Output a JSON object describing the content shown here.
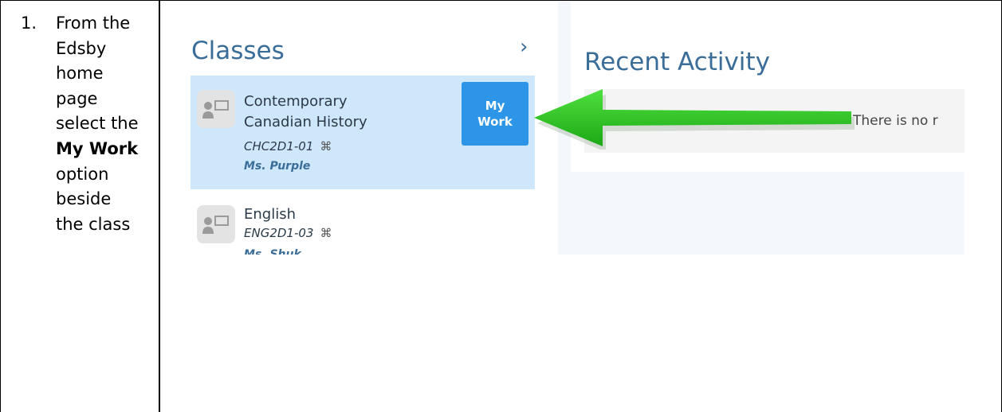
{
  "step": {
    "number": "1.",
    "text_before": "From the Edsby home page select the ",
    "text_bold": "My Work",
    "text_after": " option beside the class"
  },
  "screenshot": {
    "classes": {
      "title": "Classes",
      "chevron": "›",
      "items": [
        {
          "name": "Contemporary Canadian History",
          "code": "CHC2D1-01",
          "teacher": "Ms. Purple",
          "selected": true,
          "action_label_line1": "My",
          "action_label_line2": "Work"
        },
        {
          "name": "English",
          "code": "ENG2D1-03",
          "teacher": "Ms. Shuk"
        }
      ]
    },
    "recent_activity": {
      "title": "Recent Activity",
      "empty_text": "There is no r"
    }
  },
  "colors": {
    "accent": "#3a6e99",
    "selected_row": "#cfe7fb",
    "button": "#2c95e8",
    "arrow": "#22c41c"
  },
  "icons": [
    "class-avatar-icon",
    "code-group-icon",
    "chevron-right-icon",
    "green-arrow-icon"
  ]
}
